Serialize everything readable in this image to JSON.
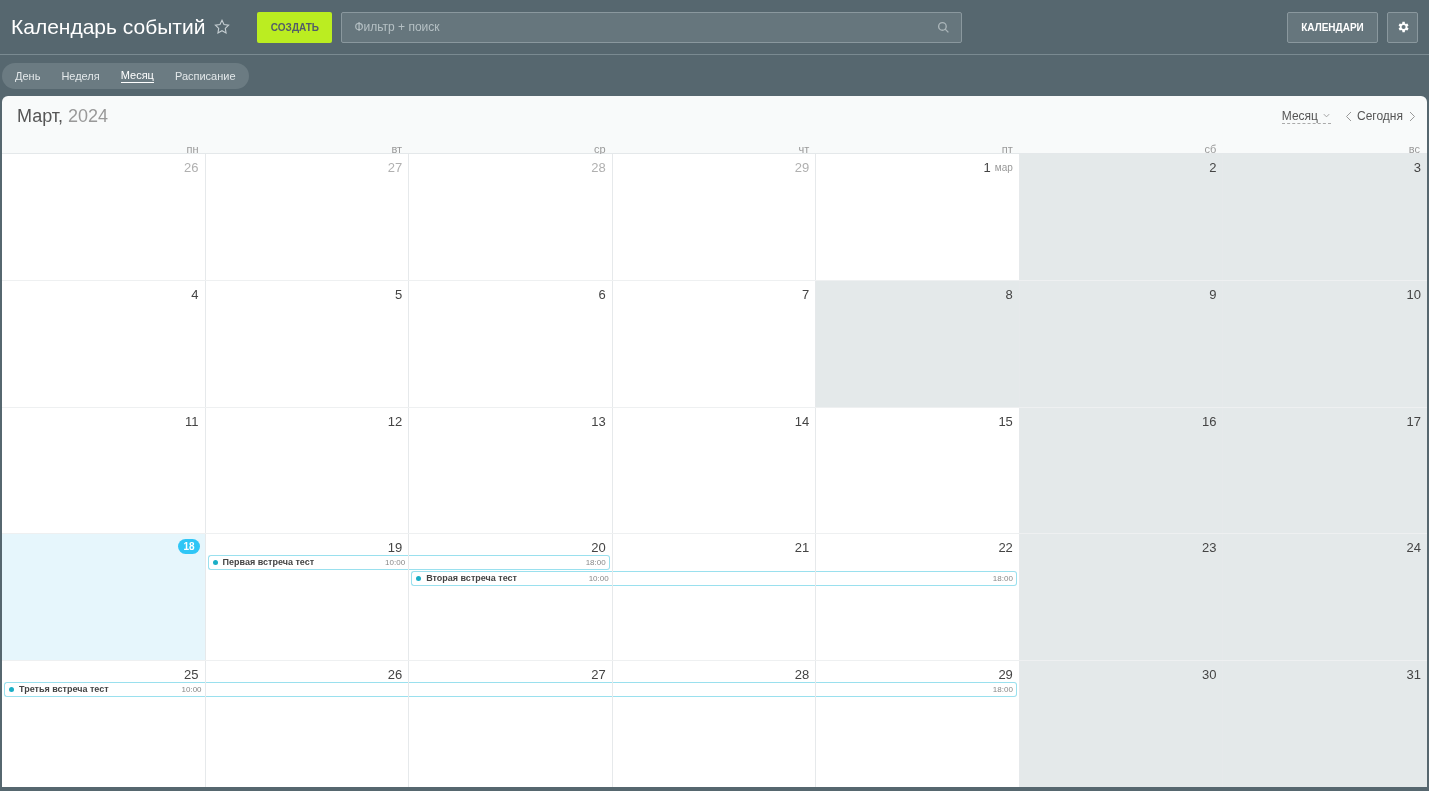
{
  "title": "Календарь событий",
  "create_button": "СОЗДАТЬ",
  "search": {
    "placeholder": "Фильтр + поиск"
  },
  "calendars_button": "КАЛЕНДАРИ",
  "views": [
    {
      "label": "День",
      "selected": false
    },
    {
      "label": "Неделя",
      "selected": false
    },
    {
      "label": "Месяц",
      "selected": true
    },
    {
      "label": "Расписание",
      "selected": false
    }
  ],
  "month": "Март,",
  "year": "2024",
  "mode_dropdown": "Месяц",
  "today_button": "Сегодня",
  "weekdays": [
    "пн",
    "вт",
    "ср",
    "чт",
    "пт",
    "сб",
    "вс"
  ],
  "weeks": [
    {
      "days": [
        {
          "day": "26",
          "outside": true,
          "off": false,
          "today": false
        },
        {
          "day": "27",
          "outside": true,
          "off": false,
          "today": false
        },
        {
          "day": "28",
          "outside": true,
          "off": false,
          "today": false
        },
        {
          "day": "29",
          "outside": true,
          "off": false,
          "today": false
        },
        {
          "day": "1",
          "month_label": "мар",
          "outside": false,
          "off": false,
          "today": false
        },
        {
          "day": "2",
          "outside": false,
          "off": true,
          "today": false
        },
        {
          "day": "3",
          "outside": false,
          "off": true,
          "today": false
        }
      ]
    },
    {
      "days": [
        {
          "day": "4",
          "outside": false,
          "off": false,
          "today": false
        },
        {
          "day": "5",
          "outside": false,
          "off": false,
          "today": false
        },
        {
          "day": "6",
          "outside": false,
          "off": false,
          "today": false
        },
        {
          "day": "7",
          "outside": false,
          "off": false,
          "today": false
        },
        {
          "day": "8",
          "outside": false,
          "off": true,
          "today": false
        },
        {
          "day": "9",
          "outside": false,
          "off": true,
          "today": false
        },
        {
          "day": "10",
          "outside": false,
          "off": true,
          "today": false
        }
      ]
    },
    {
      "days": [
        {
          "day": "11",
          "outside": false,
          "off": false,
          "today": false
        },
        {
          "day": "12",
          "outside": false,
          "off": false,
          "today": false
        },
        {
          "day": "13",
          "outside": false,
          "off": false,
          "today": false
        },
        {
          "day": "14",
          "outside": false,
          "off": false,
          "today": false
        },
        {
          "day": "15",
          "outside": false,
          "off": false,
          "today": false
        },
        {
          "day": "16",
          "outside": false,
          "off": true,
          "today": false
        },
        {
          "day": "17",
          "outside": false,
          "off": true,
          "today": false
        }
      ]
    },
    {
      "days": [
        {
          "day": "18",
          "outside": false,
          "off": false,
          "today": true
        },
        {
          "day": "19",
          "outside": false,
          "off": false,
          "today": false,
          "slots": [
            {
              "kind": "start",
              "title": "Первая встреча тест",
              "time": "10:00"
            }
          ]
        },
        {
          "day": "20",
          "outside": false,
          "off": false,
          "today": false,
          "slots": [
            {
              "kind": "end",
              "time": "18:00"
            },
            {
              "kind": "start",
              "title": "Вторая встреча тест",
              "time": "10:00"
            }
          ]
        },
        {
          "day": "21",
          "outside": false,
          "off": false,
          "today": false,
          "slots": [
            {
              "kind": "empty"
            },
            {
              "kind": "middle"
            }
          ]
        },
        {
          "day": "22",
          "outside": false,
          "off": false,
          "today": false,
          "slots": [
            {
              "kind": "empty"
            },
            {
              "kind": "end",
              "time": "18:00"
            }
          ]
        },
        {
          "day": "23",
          "outside": false,
          "off": true,
          "today": false
        },
        {
          "day": "24",
          "outside": false,
          "off": true,
          "today": false
        }
      ]
    },
    {
      "days": [
        {
          "day": "25",
          "outside": false,
          "off": false,
          "today": false,
          "slots": [
            {
              "kind": "start",
              "title": "Третья встреча тест",
              "time": "10:00"
            }
          ]
        },
        {
          "day": "26",
          "outside": false,
          "off": false,
          "today": false,
          "slots": [
            {
              "kind": "middle"
            }
          ]
        },
        {
          "day": "27",
          "outside": false,
          "off": false,
          "today": false,
          "slots": [
            {
              "kind": "middle"
            }
          ]
        },
        {
          "day": "28",
          "outside": false,
          "off": false,
          "today": false,
          "slots": [
            {
              "kind": "middle"
            }
          ]
        },
        {
          "day": "29",
          "outside": false,
          "off": false,
          "today": false,
          "slots": [
            {
              "kind": "end",
              "time": "18:00"
            }
          ]
        },
        {
          "day": "30",
          "outside": false,
          "off": true,
          "today": false
        },
        {
          "day": "31",
          "outside": false,
          "off": true,
          "today": false
        }
      ]
    }
  ]
}
